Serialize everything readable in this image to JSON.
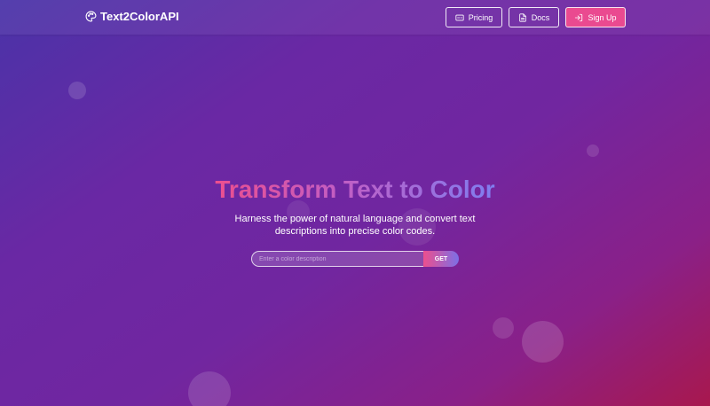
{
  "brand": {
    "name": "Text2ColorAPI",
    "icon": "palette-icon"
  },
  "nav": {
    "pricing": {
      "label": "Pricing",
      "icon": "card-icon"
    },
    "docs": {
      "label": "Docs",
      "icon": "document-icon"
    },
    "signup": {
      "label": "Sign Up",
      "icon": "login-icon"
    }
  },
  "hero": {
    "title": "Transform Text to Color",
    "subtitle": "Harness the power of natural language and convert text descriptions into precise color codes."
  },
  "search": {
    "placeholder": "Enter a color description",
    "value": "",
    "button_label": "GET"
  },
  "colors": {
    "accent_pink": "#ea4a90",
    "gradient_start": "#4a33a8",
    "gradient_end": "#a8184e",
    "title_gradient": [
      "#ec4f8e",
      "#c25ec4",
      "#7f7ef0"
    ]
  }
}
